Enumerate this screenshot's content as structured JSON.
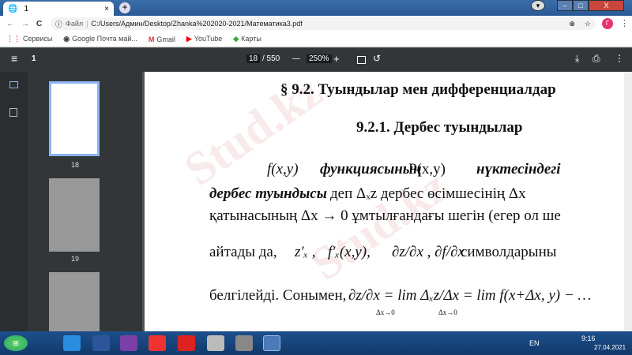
{
  "tab": {
    "title": "1",
    "close": "×",
    "new": "+"
  },
  "window": {
    "min": "–",
    "max": "□",
    "close": "X"
  },
  "address": {
    "back": "←",
    "forward": "→",
    "reload": "C",
    "info": "ⓘ",
    "scheme": "Файл",
    "url": "C:/Users/Админ/Desktop/Zhanka%202020-2021/Математика3.pdf",
    "zoom_icon": "⊕",
    "star": "☆",
    "avatar": "Г",
    "menu": "⋮"
  },
  "bookmarks": [
    {
      "icon": "⋮⋮",
      "label": "Сервисы"
    },
    {
      "icon": "◉",
      "label": "Google Почта май..."
    },
    {
      "icon": "M",
      "label": "Gmail"
    },
    {
      "icon": "▶",
      "label": "YouTube"
    },
    {
      "icon": "◆",
      "label": "Карты"
    }
  ],
  "pdf": {
    "menu": "≡",
    "title": "1",
    "page": "18",
    "total": "/ 550",
    "minus": "—",
    "zoom": "250%",
    "plus": "+",
    "download": "⤓",
    "print": "⎙",
    "more": "⋮"
  },
  "thumbs": [
    {
      "label": "18"
    },
    {
      "label": "19"
    }
  ],
  "doc": {
    "heading": "§ 9.2.  Туындылар мен дифференциалдар",
    "subheading": "9.2.1. Дербес туындылар",
    "l1a": "f(x,y)",
    "l1b": "функциясының",
    "l1c": "P(x,y)",
    "l1d": "нүктесіндегі",
    "l2a": "дербес туындысы",
    "l2b": "деп  Δₓz  дербес өсімшесінің  Δx",
    "l3": "қатынасының Δx → 0 ұмтылғандағы шегін (егер ол ше",
    "l4a": "айтады  да,",
    "l4b": "z′ₓ ,",
    "l4c": "f′ₓ(x,y),",
    "l4d": "∂z/∂x , ∂f/∂x",
    "l4e": "символдарыны",
    "l5a": "белгілейді. Сонымен,",
    "l5b": "∂z/∂x = lim Δₓz/Δx = lim f(x+Δx, y) − …",
    "l5c": "Δx→0",
    "l5d": "Δx→0",
    "watermark": "Stud.kz - Stud.kz"
  },
  "taskbar": {
    "start": "⊞",
    "lang": "EN",
    "time": "9:16",
    "date": "27.04.2021"
  }
}
